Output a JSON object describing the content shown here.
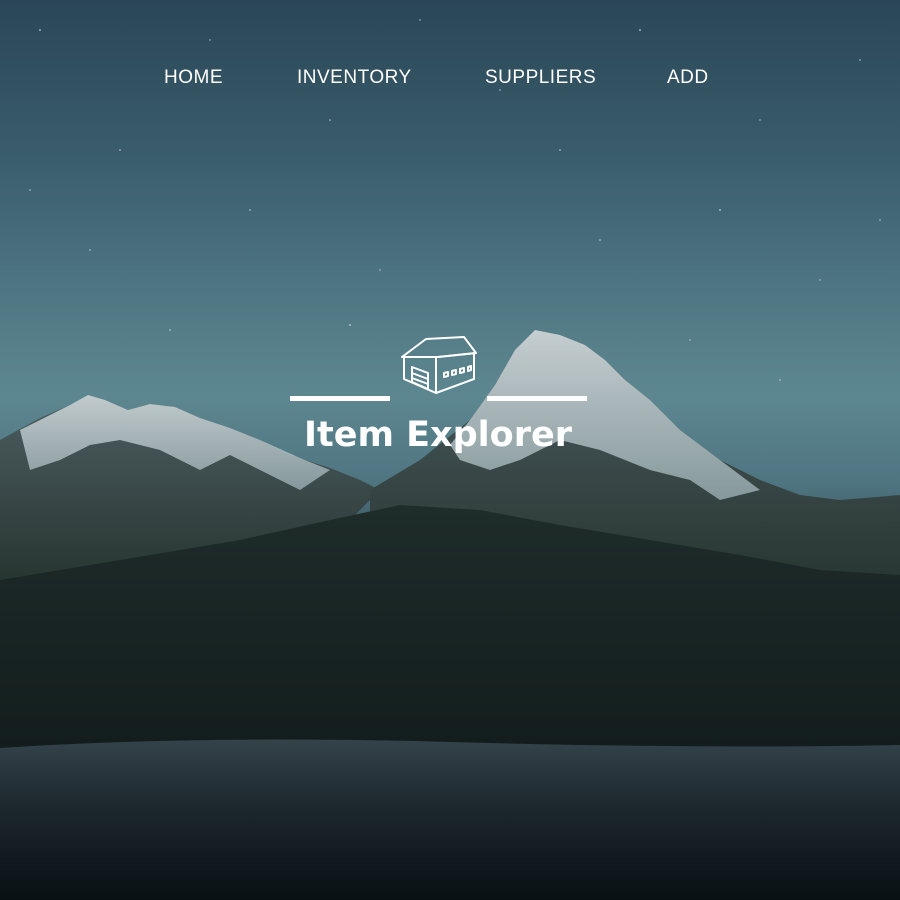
{
  "nav": {
    "items": [
      {
        "label": "HOME"
      },
      {
        "label": "INVENTORY"
      },
      {
        "label": "SUPPLIERS"
      },
      {
        "label": "ADD"
      }
    ]
  },
  "hero": {
    "icon": "warehouse-icon",
    "title": "Item Explorer"
  },
  "colors": {
    "text": "#ffffff",
    "sky_top": "#2a4656",
    "sky_mid": "#5d8790",
    "ground": "#0c1418"
  }
}
